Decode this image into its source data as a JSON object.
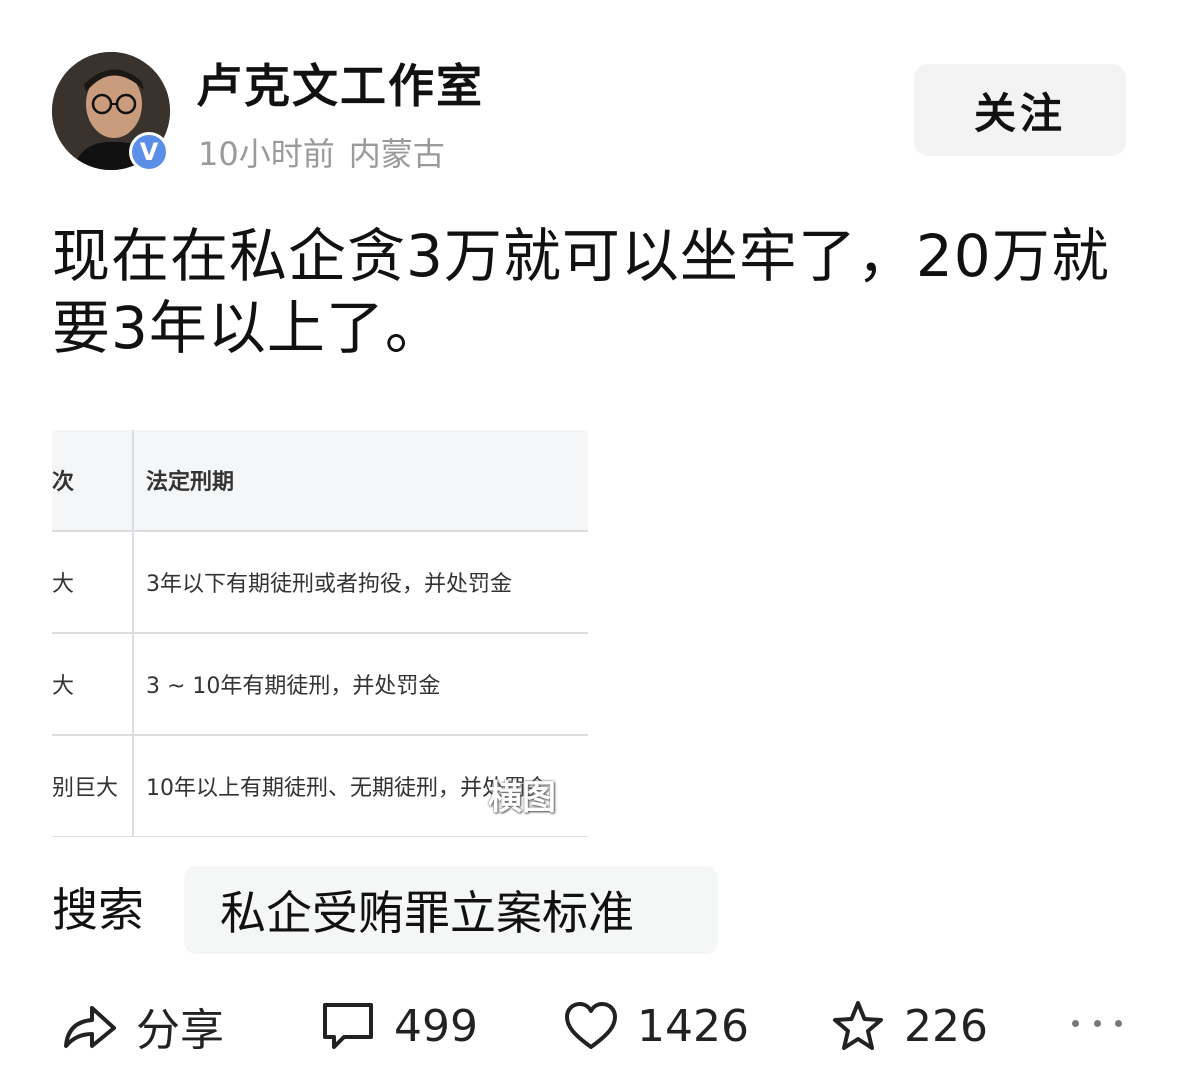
{
  "author": {
    "name": "卢克文工作室",
    "time_ago": "10小时前",
    "location": "内蒙古",
    "verified_mark": "V"
  },
  "follow_label": "关注",
  "post_text": "现在在私企贪3万就可以坐牢了，20万就要3年以上了。",
  "table_image": {
    "headers": [
      "次",
      "法定刑期"
    ],
    "rows": [
      {
        "c1": "大",
        "c2": "3年以下有期徒刑或者拘役，并处罚金"
      },
      {
        "c1": "大",
        "c2": "3 ~ 10年有期徒刑，并处罚金"
      },
      {
        "c1": "别巨大",
        "c2": "10年以上有期徒刑、无期徒刑，并处罚金"
      }
    ],
    "watermark": "横图"
  },
  "search": {
    "label": "搜索",
    "query": "私企受贿罪立案标准"
  },
  "actions": {
    "share_label": "分享",
    "comments": "499",
    "likes": "1426",
    "favorites": "226"
  },
  "icons": [
    "verified-badge-icon",
    "share-icon",
    "comment-icon",
    "heart-icon",
    "star-icon",
    "more-icon"
  ]
}
